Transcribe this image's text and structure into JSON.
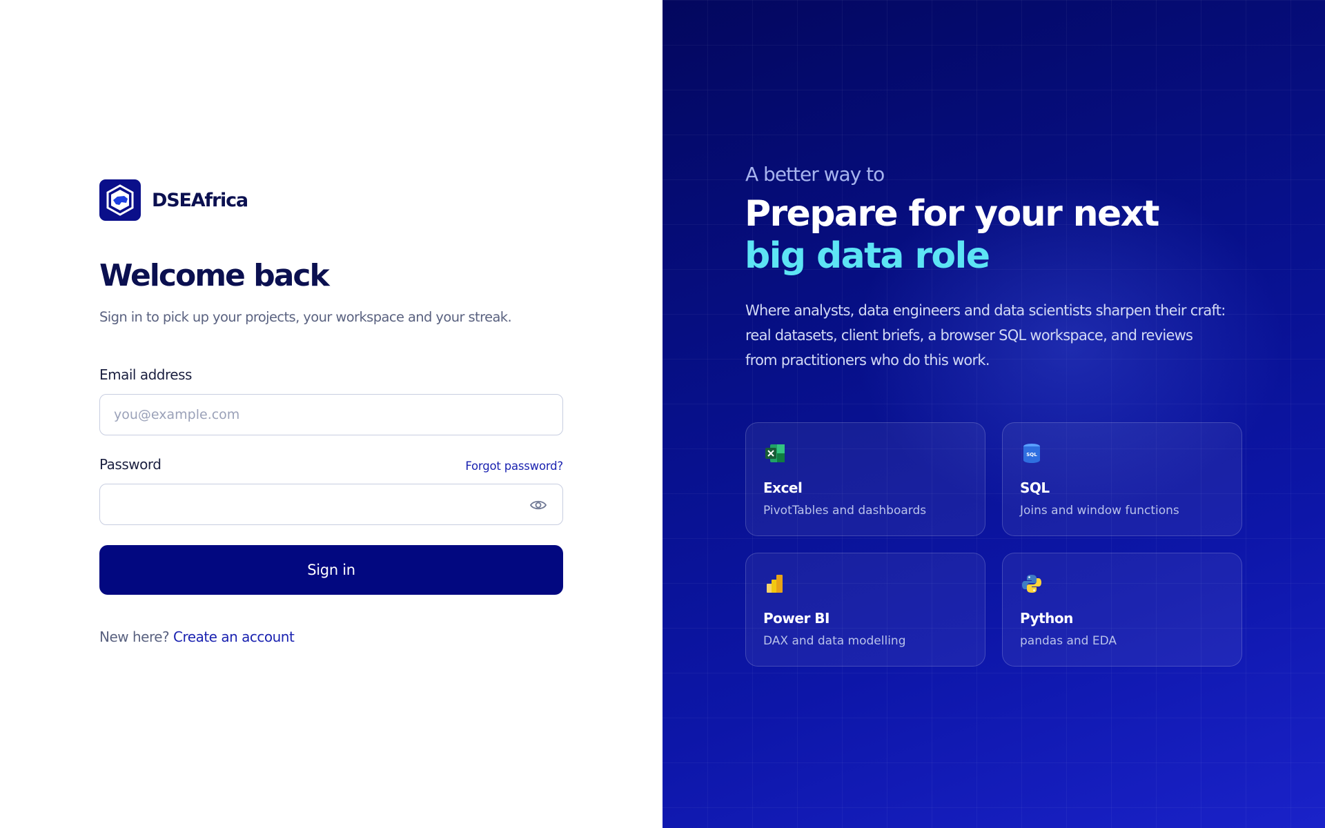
{
  "brand": {
    "name": "DSEAfrica"
  },
  "login": {
    "title": "Welcome back",
    "subtitle": "Sign in to pick up your projects, your workspace and your streak.",
    "email_label": "Email address",
    "email_placeholder": "you@example.com",
    "email_value": "",
    "password_label": "Password",
    "password_value": "",
    "forgot_label": "Forgot password?",
    "signin_label": "Sign in",
    "new_here": "New here?",
    "create_account": "Create an account"
  },
  "hero": {
    "kicker": "A better way to",
    "line1": "Prepare for your next",
    "line2": "big data role",
    "description": "Where analysts, data engineers and data scientists sharpen their craft: real datasets, client briefs, a browser SQL workspace, and reviews from practitioners who do this work."
  },
  "cards": [
    {
      "title": "Excel",
      "subtitle": "PivotTables and dashboards",
      "icon": "excel-icon"
    },
    {
      "title": "SQL",
      "subtitle": "Joins and window functions",
      "icon": "sql-icon"
    },
    {
      "title": "Power BI",
      "subtitle": "DAX and data modelling",
      "icon": "powerbi-icon"
    },
    {
      "title": "Python",
      "subtitle": "pandas and EDA",
      "icon": "python-icon"
    }
  ],
  "colors": {
    "primary": "#020880",
    "link": "#1a22b0",
    "accent": "#5de4f4",
    "heading": "#0b1050"
  }
}
